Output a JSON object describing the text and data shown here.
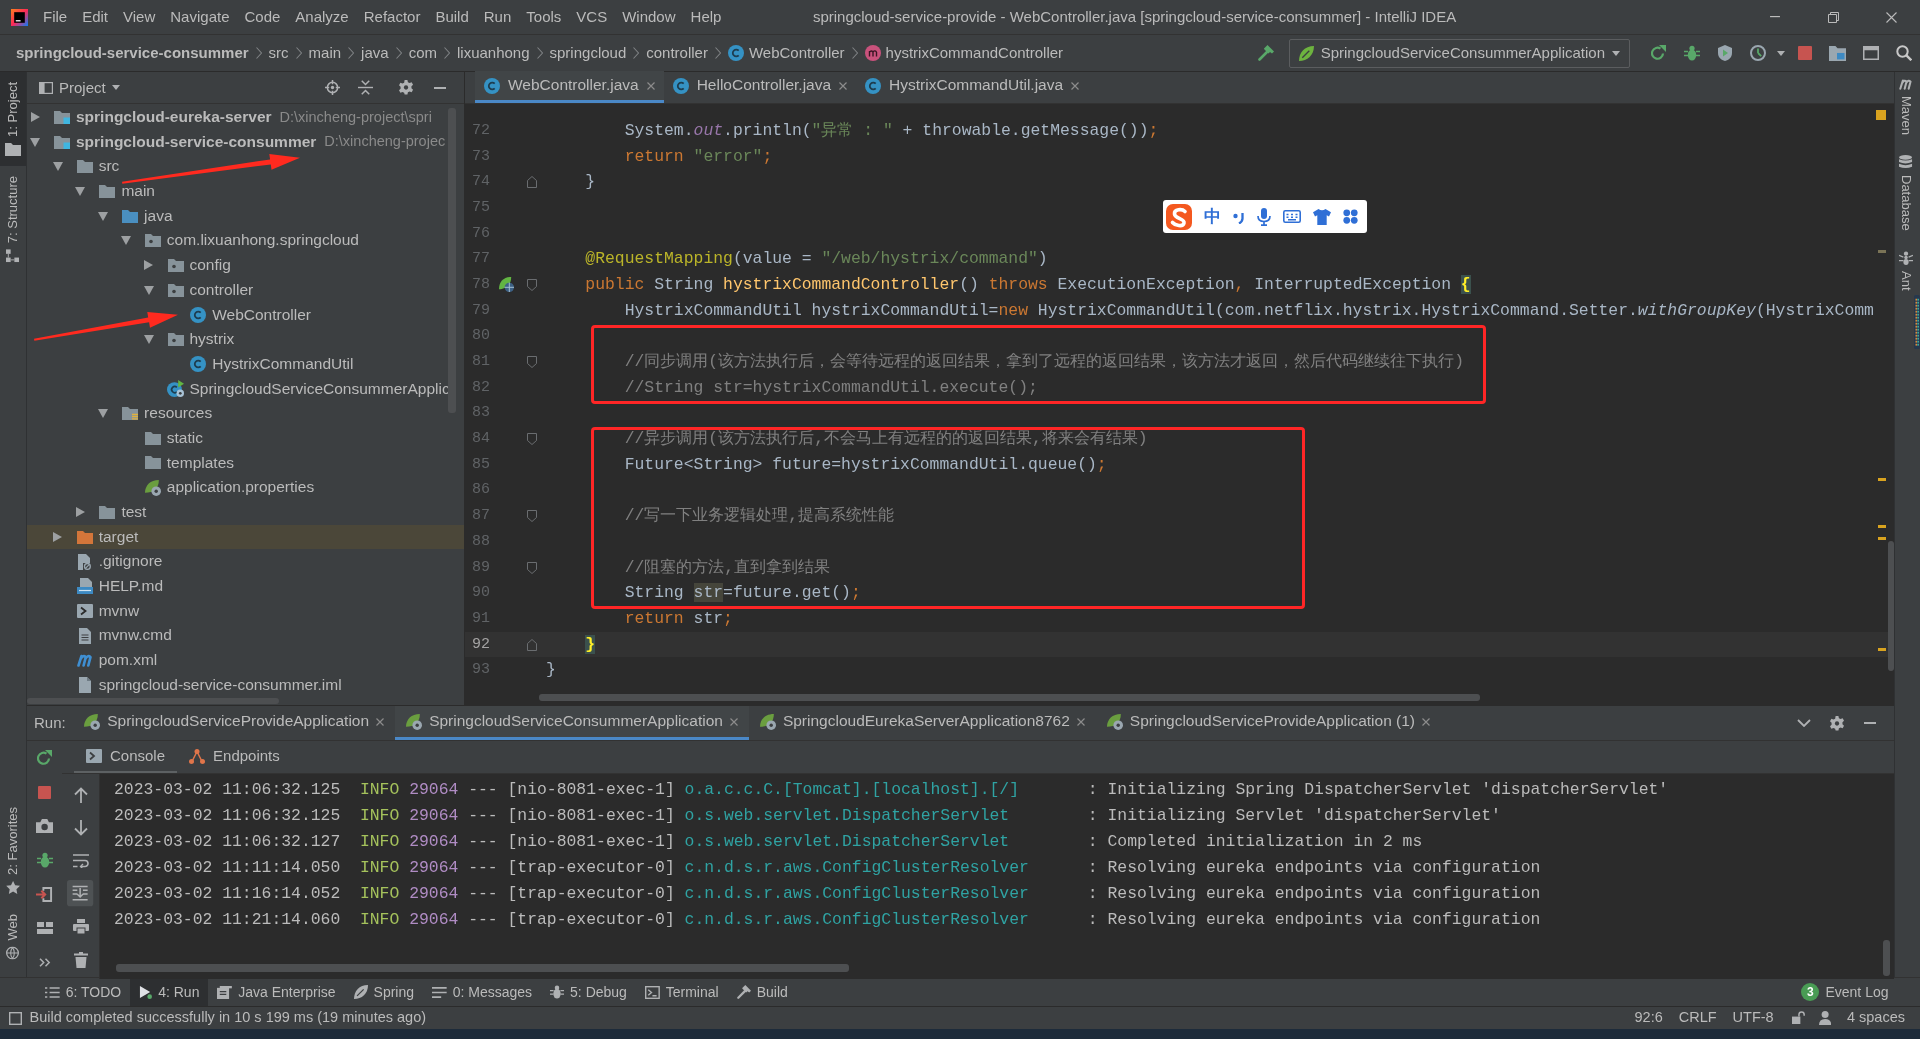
{
  "window": {
    "title": "springcloud-service-provide - WebController.java [springcloud-service-consummer] - IntelliJ IDEA"
  },
  "menu": [
    "File",
    "Edit",
    "View",
    "Navigate",
    "Code",
    "Analyze",
    "Refactor",
    "Build",
    "Run",
    "Tools",
    "VCS",
    "Window",
    "Help"
  ],
  "breadcrumbs": [
    {
      "label": "springcloud-service-consummer",
      "kind": "module"
    },
    {
      "label": "src",
      "kind": "folder"
    },
    {
      "label": "main",
      "kind": "folder"
    },
    {
      "label": "java",
      "kind": "folder"
    },
    {
      "label": "com",
      "kind": "folder"
    },
    {
      "label": "lixuanhong",
      "kind": "folder"
    },
    {
      "label": "springcloud",
      "kind": "folder"
    },
    {
      "label": "controller",
      "kind": "folder"
    },
    {
      "label": "WebController",
      "kind": "class"
    },
    {
      "label": "hystrixCommandController",
      "kind": "method"
    }
  ],
  "run_configuration": {
    "label": "SpringcloudServiceConsummerApplication"
  },
  "left_tools": {
    "top": [
      {
        "label": "1: Project",
        "kind": "project",
        "selected": true
      },
      {
        "label": "7: Structure",
        "kind": "structure",
        "selected": false
      }
    ],
    "bottom": [
      {
        "label": "2: Favorites",
        "kind": "favorites",
        "selected": false
      },
      {
        "label": "Web",
        "kind": "web",
        "selected": false
      }
    ]
  },
  "project_panel": {
    "title": "Project",
    "tree": [
      {
        "label": "springcloud-eureka-server",
        "path": "D:\\xincheng-project\\spri",
        "kind": "module",
        "expanded": false,
        "selected": false
      },
      {
        "label": "springcloud-service-consummer",
        "path": "D:\\xincheng-projec",
        "kind": "module",
        "expanded": true,
        "selected": false,
        "annotation_arrow": true,
        "children": [
          {
            "label": "src",
            "kind": "folder",
            "expanded": true,
            "selected": false,
            "children": [
              {
                "label": "main",
                "kind": "folder",
                "expanded": true,
                "selected": false,
                "children": [
                  {
                    "label": "java",
                    "kind": "source-folder",
                    "expanded": true,
                    "selected": false,
                    "children": [
                      {
                        "label": "com.lixuanhong.springcloud",
                        "kind": "package",
                        "expanded": true,
                        "selected": false,
                        "children": [
                          {
                            "label": "config",
                            "kind": "package",
                            "expanded": false,
                            "selected": false
                          },
                          {
                            "label": "controller",
                            "kind": "package",
                            "expanded": true,
                            "selected": false,
                            "children": [
                              {
                                "label": "WebController",
                                "kind": "class",
                                "selected": false,
                                "annotation_arrow": true
                              }
                            ]
                          },
                          {
                            "label": "hystrix",
                            "kind": "package",
                            "expanded": true,
                            "selected": false,
                            "children": [
                              {
                                "label": "HystrixCommandUtil",
                                "kind": "class",
                                "selected": false
                              }
                            ]
                          },
                          {
                            "label": "SpringcloudServiceConsummerApplic",
                            "kind": "spring-app",
                            "selected": false
                          }
                        ]
                      }
                    ]
                  },
                  {
                    "label": "resources",
                    "kind": "resources-folder",
                    "expanded": true,
                    "selected": false,
                    "children": [
                      {
                        "label": "static",
                        "kind": "folder",
                        "selected": false
                      },
                      {
                        "label": "templates",
                        "kind": "folder",
                        "selected": false
                      },
                      {
                        "label": "application.properties",
                        "kind": "spring-properties",
                        "selected": false
                      }
                    ]
                  }
                ]
              },
              {
                "label": "test",
                "kind": "folder",
                "expanded": false,
                "selected": false
              }
            ]
          },
          {
            "label": "target",
            "kind": "excluded-folder",
            "expanded": false,
            "selected": true
          },
          {
            "label": ".gitignore",
            "kind": "gitignore",
            "selected": false
          },
          {
            "label": "HELP.md",
            "kind": "markdown",
            "selected": false
          },
          {
            "label": "mvnw",
            "kind": "shell",
            "selected": false
          },
          {
            "label": "mvnw.cmd",
            "kind": "text-file",
            "selected": false
          },
          {
            "label": "pom.xml",
            "kind": "maven",
            "selected": false
          },
          {
            "label": "springcloud-service-consummer.iml",
            "kind": "module-file",
            "selected": false
          }
        ]
      }
    ]
  },
  "editor": {
    "tabs": [
      {
        "label": "WebController.java",
        "selected": true
      },
      {
        "label": "HelloController.java",
        "selected": false
      },
      {
        "label": "HystrixCommandUtil.java",
        "selected": false
      }
    ],
    "blocks": [
      {
        "boxed": false,
        "lines": [
          {
            "number": "72",
            "current": false,
            "tokens": [
              {
                "kind": "plain",
                "text": "        System."
              },
              {
                "kind": "field",
                "text": "out"
              },
              {
                "kind": "plain",
                "text": ".println("
              },
              {
                "kind": "string",
                "text": "\"异常 : \""
              },
              {
                "kind": "plain",
                "text": " + throwable.getMessage())"
              },
              {
                "kind": "keyword",
                "text": ";"
              }
            ]
          },
          {
            "number": "73",
            "current": false,
            "tokens": [
              {
                "kind": "keyword",
                "text": "        return "
              },
              {
                "kind": "string",
                "text": "\"error\""
              },
              {
                "kind": "keyword",
                "text": ";"
              }
            ]
          },
          {
            "number": "74",
            "current": false,
            "fold_end": true,
            "tokens": [
              {
                "kind": "plain",
                "text": "    }"
              }
            ]
          },
          {
            "number": "75",
            "current": false
          },
          {
            "number": "76",
            "current": false
          },
          {
            "number": "77",
            "current": false,
            "tokens": [
              {
                "kind": "annotation",
                "text": "    @RequestMapping"
              },
              {
                "kind": "plain",
                "text": "(value = "
              },
              {
                "kind": "string",
                "text": "\"/web/hystrix/command\""
              },
              {
                "kind": "plain",
                "text": ")"
              }
            ]
          },
          {
            "number": "78",
            "current": false,
            "fold_start": true,
            "gutter_icon": true,
            "tokens": [
              {
                "kind": "keyword",
                "text": "    public "
              },
              {
                "kind": "plain",
                "text": "String "
              },
              {
                "kind": "declaration",
                "text": "hystrixCommandController"
              },
              {
                "kind": "plain",
                "text": "() "
              },
              {
                "kind": "keyword",
                "text": "throws "
              },
              {
                "kind": "plain",
                "text": "ExecutionException"
              },
              {
                "kind": "keyword",
                "text": ", "
              },
              {
                "kind": "plain",
                "text": "InterruptedException "
              },
              {
                "kind": "brace",
                "text": "{"
              }
            ]
          },
          {
            "number": "79",
            "current": false,
            "tokens": [
              {
                "kind": "plain",
                "text": "        HystrixCommandUtil hystrixCommandUtil="
              },
              {
                "kind": "keyword",
                "text": "new "
              },
              {
                "kind": "plain",
                "text": "HystrixCommandUtil(com.netflix.hystrix.HystrixCommand.Setter."
              },
              {
                "kind": "call",
                "text": "withGroupKey"
              },
              {
                "kind": "plain",
                "text": "(HystrixComm"
              }
            ]
          }
        ]
      },
      {
        "boxed": true,
        "lines": [
          {
            "number": "80",
            "current": false
          },
          {
            "number": "81",
            "current": false,
            "fold_start": true,
            "tokens": [
              {
                "kind": "comment",
                "text": "        //同步调用(该方法执行后，会等待远程的返回结果，拿到了远程的返回结果，该方法才返回，然后代码继续往下执行)"
              }
            ]
          },
          {
            "number": "82",
            "current": false,
            "tokens": [
              {
                "kind": "comment",
                "text": "        //String str=hystrixCommandUtil.execute();"
              }
            ]
          }
        ]
      },
      {
        "boxed": false,
        "lines": [
          {
            "number": "83",
            "current": false
          }
        ]
      },
      {
        "boxed": true,
        "lines": [
          {
            "number": "84",
            "current": false,
            "fold_start": true,
            "tokens": [
              {
                "kind": "comment",
                "text": "        //异步调用(该方法执行后,不会马上有远程的的返回结果,将来会有结果)"
              }
            ]
          },
          {
            "number": "85",
            "current": false,
            "tokens": [
              {
                "kind": "plain",
                "text": "        Future<String> future=hystrixCommandUtil.queue()"
              },
              {
                "kind": "keyword",
                "text": ";"
              }
            ]
          },
          {
            "number": "86",
            "current": false
          },
          {
            "number": "87",
            "current": false,
            "fold_start": true,
            "tokens": [
              {
                "kind": "comment",
                "text": "        //写一下业务逻辑处理,提高系统性能"
              }
            ]
          },
          {
            "number": "88",
            "current": false
          },
          {
            "number": "89",
            "current": false,
            "fold_start": true,
            "tokens": [
              {
                "kind": "comment",
                "text": "        //阻塞的方法,直到拿到结果"
              }
            ]
          },
          {
            "number": "90",
            "current": false,
            "tokens": [
              {
                "kind": "plain",
                "text": "        String "
              },
              {
                "kind": "usage",
                "text": "str"
              },
              {
                "kind": "plain",
                "text": "=future.get()"
              },
              {
                "kind": "keyword",
                "text": ";"
              }
            ]
          }
        ]
      },
      {
        "boxed": false,
        "lines": [
          {
            "number": "91",
            "current": false,
            "tokens": [
              {
                "kind": "keyword",
                "text": "        return "
              },
              {
                "kind": "plain",
                "text": "str"
              },
              {
                "kind": "keyword",
                "text": ";"
              }
            ]
          },
          {
            "number": "92",
            "current": true,
            "fold_end": true,
            "tokens": [
              {
                "kind": "brace",
                "text": "    }"
              }
            ]
          },
          {
            "number": "93",
            "current": false,
            "tokens": [
              {
                "kind": "plain",
                "text": "}"
              }
            ]
          }
        ]
      }
    ],
    "ime_toolbar": {
      "mode": "中"
    }
  },
  "right_tools": [
    {
      "label": "Maven",
      "kind": "maven"
    },
    {
      "label": "Database",
      "kind": "database"
    },
    {
      "label": "Ant",
      "kind": "ant"
    }
  ],
  "run_panel": {
    "title": "Run:",
    "tabs": [
      {
        "label": "SpringcloudServiceProvideApplication",
        "selected": false
      },
      {
        "label": "SpringcloudServiceConsummerApplication",
        "selected": true
      },
      {
        "label": "SpringcloudEurekaServerApplication8762",
        "selected": false
      },
      {
        "label": "SpringcloudServiceProvideApplication (1)",
        "selected": false
      }
    ],
    "subtabs": [
      {
        "label": "Console",
        "kind": "console",
        "selected": true
      },
      {
        "label": "Endpoints",
        "kind": "endpoints",
        "selected": false
      }
    ],
    "console_tools": [
      {
        "kind": "up",
        "on": false
      },
      {
        "kind": "down",
        "on": false
      },
      {
        "kind": "wrap",
        "on": false
      },
      {
        "kind": "scroll",
        "on": true
      },
      {
        "kind": "print",
        "on": false
      },
      {
        "kind": "clear",
        "on": false
      }
    ],
    "console": [
      {
        "timestamp": "2023-03-02 11:06:32.125",
        "severity": "INFO",
        "pid": "29064",
        "separator": "---",
        "thread": "[nio-8081-exec-1]",
        "logger": "o.a.c.c.C.[Tomcat].[localhost].[/]",
        "message": ": Initializing Spring DispatcherServlet 'dispatcherServlet'"
      },
      {
        "timestamp": "2023-03-02 11:06:32.125",
        "severity": "INFO",
        "pid": "29064",
        "separator": "---",
        "thread": "[nio-8081-exec-1]",
        "logger": "o.s.web.servlet.DispatcherServlet",
        "message": ": Initializing Servlet 'dispatcherServlet'"
      },
      {
        "timestamp": "2023-03-02 11:06:32.127",
        "severity": "INFO",
        "pid": "29064",
        "separator": "---",
        "thread": "[nio-8081-exec-1]",
        "logger": "o.s.web.servlet.DispatcherServlet",
        "message": ": Completed initialization in 2 ms"
      },
      {
        "timestamp": "2023-03-02 11:11:14.050",
        "severity": "INFO",
        "pid": "29064",
        "separator": "---",
        "thread": "[trap-executor-0]",
        "logger": "c.n.d.s.r.aws.ConfigClusterResolver",
        "message": ": Resolving eureka endpoints via configuration"
      },
      {
        "timestamp": "2023-03-02 11:16:14.052",
        "severity": "INFO",
        "pid": "29064",
        "separator": "---",
        "thread": "[trap-executor-0]",
        "logger": "c.n.d.s.r.aws.ConfigClusterResolver",
        "message": ": Resolving eureka endpoints via configuration"
      },
      {
        "timestamp": "2023-03-02 11:21:14.060",
        "severity": "INFO",
        "pid": "29064",
        "separator": "---",
        "thread": "[trap-executor-0]",
        "logger": "c.n.d.s.r.aws.ConfigClusterResolver",
        "message": ": Resolving eureka endpoints via configuration"
      }
    ]
  },
  "tool_buttons": [
    {
      "label": "6: TODO",
      "kind": "todo",
      "selected": false
    },
    {
      "label": "4: Run",
      "kind": "run",
      "selected": true
    },
    {
      "label": "Java Enterprise",
      "kind": "enterprise",
      "selected": false
    },
    {
      "label": "Spring",
      "kind": "spring",
      "selected": false
    },
    {
      "label": "0: Messages",
      "kind": "messages",
      "selected": false
    },
    {
      "label": "5: Debug",
      "kind": "debug",
      "selected": false
    },
    {
      "label": "Terminal",
      "kind": "terminal",
      "selected": false
    },
    {
      "label": "Build",
      "kind": "build",
      "selected": false
    }
  ],
  "event_log": {
    "label": "Event Log",
    "badge": "3"
  },
  "status_bar": {
    "message": "Build completed successfully in 10 s 199 ms (19 minutes ago)",
    "position": "92:6",
    "line_separator": "CRLF",
    "encoding": "UTF-8",
    "indent": "4 spaces"
  }
}
